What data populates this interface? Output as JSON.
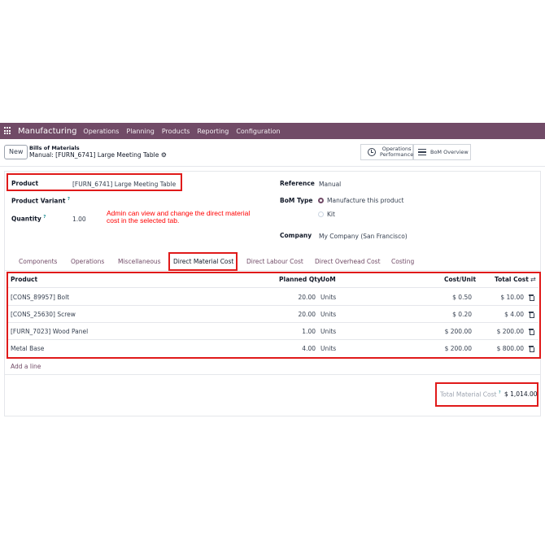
{
  "nav": {
    "app": "Manufacturing",
    "menu": [
      "Operations",
      "Planning",
      "Products",
      "Reporting",
      "Configuration"
    ]
  },
  "control": {
    "new_label": "New",
    "breadcrumb_parent": "Bills of Materials",
    "breadcrumb_current": "Manual: [FURN_6741] Large Meeting Table",
    "smart_ops_line1": "Operations",
    "smart_ops_line2": "Performance",
    "smart_bom": "BoM Overview"
  },
  "form": {
    "product_label": "Product",
    "product_value": "[FURN_6741] Large Meeting Table",
    "variant_label": "Product Variant",
    "quantity_label": "Quantity",
    "quantity_value": "1.00",
    "help_mark": "?",
    "reference_label": "Reference",
    "reference_value": "Manual",
    "bom_type_label": "BoM Type",
    "bom_type_options": [
      "Manufacture this product",
      "Kit"
    ],
    "company_label": "Company",
    "company_value": "My Company (San Francisco)"
  },
  "annotation": {
    "line1": "Admin can view and change the direct material",
    "line2": "cost in the selected tab."
  },
  "tabs": [
    "Components",
    "Operations",
    "Miscellaneous",
    "Direct Material Cost",
    "Direct Labour Cost",
    "Direct Overhead Cost",
    "Costing"
  ],
  "table": {
    "headers": [
      "Product",
      "Planned Qty",
      "UoM",
      "Cost/Unit",
      "Total Cost"
    ],
    "rows": [
      {
        "product": "[CONS_89957] Bolt",
        "qty": "20.00",
        "uom": "Units",
        "unit": "$ 0.50",
        "total": "$ 10.00"
      },
      {
        "product": "[CONS_25630] Screw",
        "qty": "20.00",
        "uom": "Units",
        "unit": "$ 0.20",
        "total": "$ 4.00"
      },
      {
        "product": "[FURN_7023] Wood Panel",
        "qty": "1.00",
        "uom": "Units",
        "unit": "$ 200.00",
        "total": "$ 200.00"
      },
      {
        "product": "Metal Base",
        "qty": "4.00",
        "uom": "Units",
        "unit": "$ 200.00",
        "total": "$ 800.00"
      }
    ],
    "add_line": "Add a line"
  },
  "footer": {
    "total_label": "Total Material Cost",
    "total_value": "$ 1,014.00"
  },
  "colors": {
    "brand": "#714b67",
    "highlight": "#e01a1a",
    "annotation": "#ff0000"
  }
}
